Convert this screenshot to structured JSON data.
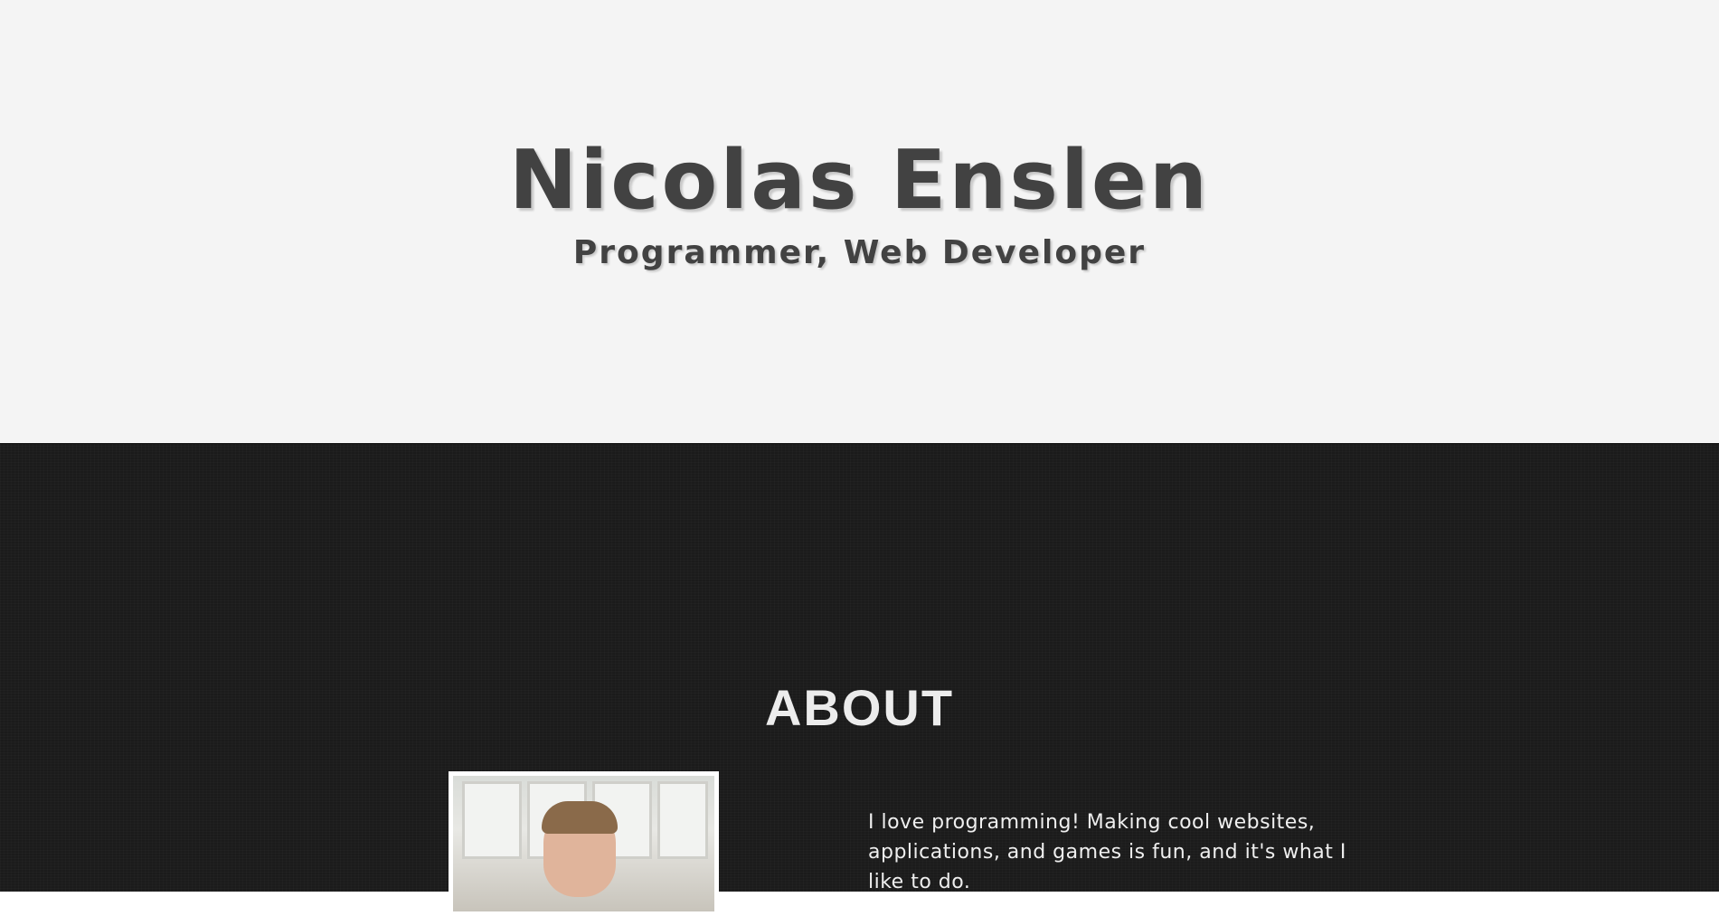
{
  "hero": {
    "name": "Nicolas Enslen",
    "subtitle": "Programmer, Web Developer"
  },
  "about": {
    "heading": "ABOUT",
    "photo_icon": "profile-photo",
    "text": "I love programming! Making cool websites, applications, and games is fun, and it's what I like to do."
  },
  "colors": {
    "hero_bg": "#f4f4f4",
    "hero_text": "#424242",
    "about_bg": "#1b1b1b",
    "about_text": "#efefef"
  }
}
